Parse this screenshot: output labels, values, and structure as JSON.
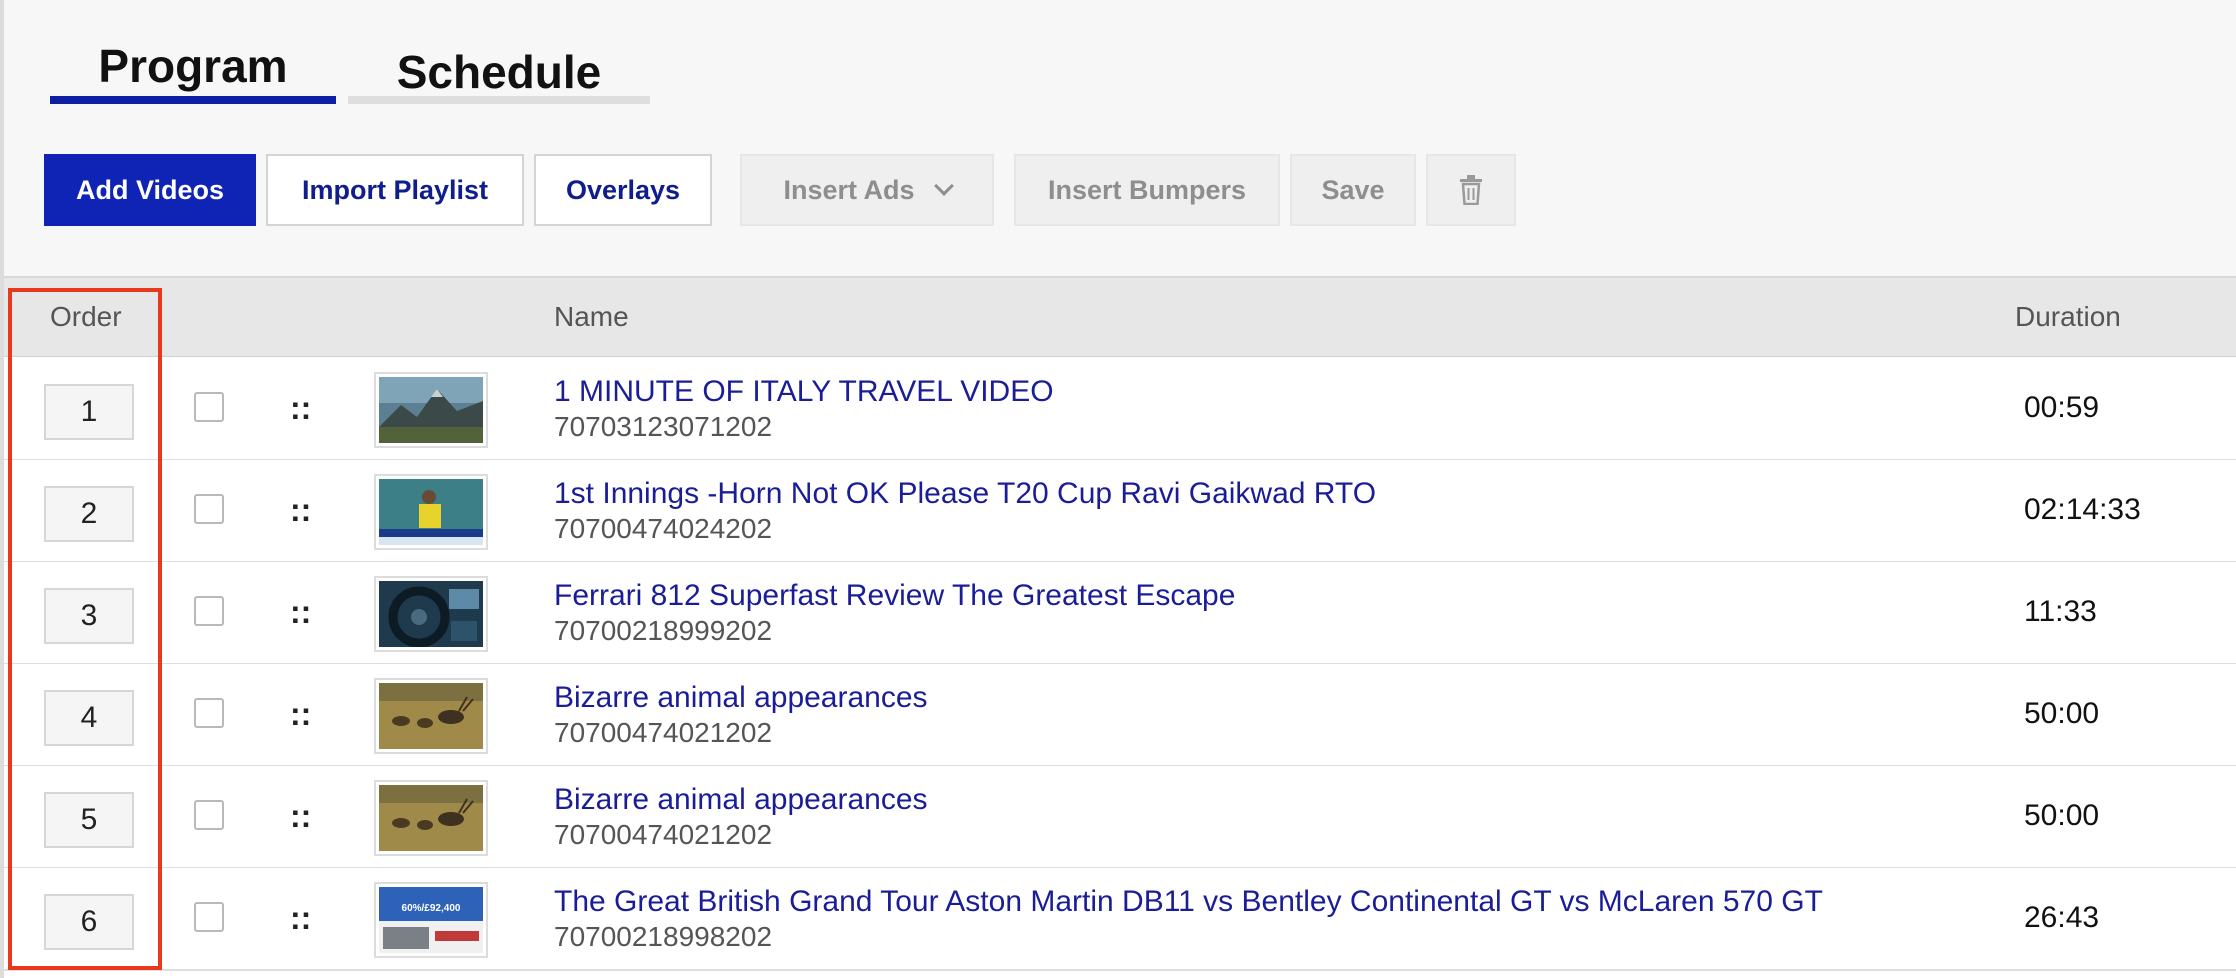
{
  "tabs": [
    {
      "label": "Program",
      "active": true
    },
    {
      "label": "Schedule",
      "active": false
    }
  ],
  "toolbar": {
    "add_videos": "Add Videos",
    "import_playlist": "Import Playlist",
    "overlays": "Overlays",
    "insert_ads": "Insert Ads",
    "insert_bumpers": "Insert Bumpers",
    "save": "Save",
    "delete_icon": "trash-icon"
  },
  "table": {
    "columns": {
      "order": "Order",
      "name": "Name",
      "duration": "Duration"
    },
    "rows": [
      {
        "order": "1",
        "title": "1 MINUTE OF ITALY TRAVEL VIDEO",
        "id": "70703123071202",
        "duration": "00:59",
        "thumb": "mountains"
      },
      {
        "order": "2",
        "title": "1st Innings -Horn Not OK Please T20 Cup Ravi Gaikwad RTO",
        "id": "70700474024202",
        "duration": "02:14:33",
        "thumb": "cricket"
      },
      {
        "order": "3",
        "title": "Ferrari 812 Superfast Review The Greatest Escape",
        "id": "70700218999202",
        "duration": "11:33",
        "thumb": "car-interior"
      },
      {
        "order": "4",
        "title": "Bizarre animal appearances",
        "id": "70700474021202",
        "duration": "50:00",
        "thumb": "deer"
      },
      {
        "order": "5",
        "title": "Bizarre animal appearances",
        "id": "70700474021202",
        "duration": "50:00",
        "thumb": "deer"
      },
      {
        "order": "6",
        "title": "The Great British Grand Tour Aston Martin DB11 vs Bentley Continental GT vs McLaren 570 GT",
        "id": "70700218998202",
        "duration": "26:43",
        "thumb": "car-ad"
      }
    ]
  },
  "thumb_text": {
    "row6_price": "60%/£92,400"
  },
  "colors": {
    "accent": "#0f23b5",
    "link": "#1a1d97",
    "highlight": "#e8391f"
  }
}
